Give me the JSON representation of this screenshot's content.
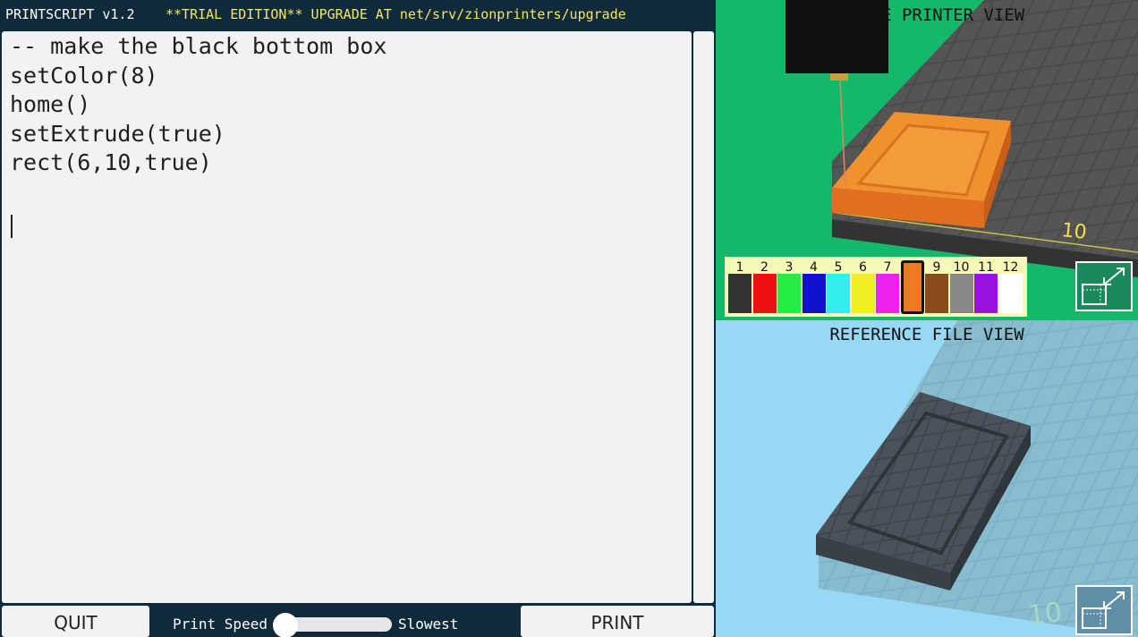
{
  "header": {
    "app_title": "PRINTSCRIPT v1.2",
    "trial_notice": "**TRIAL EDITION** UPGRADE AT net/srv/zionprinters/upgrade"
  },
  "editor": {
    "lines": [
      "-- make the black bottom box",
      "setColor(8)",
      "home()",
      "setExtrude(true)",
      "rect(6,10,true)"
    ]
  },
  "footer": {
    "quit_label": "QUIT",
    "speed_label": "Print Speed",
    "slowest_label": "Slowest",
    "print_label": "PRINT",
    "speed_value": 0
  },
  "live_view": {
    "title": "LIVE PRINTER VIEW",
    "grid_label": "10",
    "selected_color": 8,
    "palette": [
      {
        "num": "1",
        "color": "#333333"
      },
      {
        "num": "2",
        "color": "#ee1111"
      },
      {
        "num": "3",
        "color": "#22ee44"
      },
      {
        "num": "4",
        "color": "#1111cc"
      },
      {
        "num": "5",
        "color": "#33eeee"
      },
      {
        "num": "6",
        "color": "#eeee22"
      },
      {
        "num": "7",
        "color": "#ee22ee"
      },
      {
        "num": "8",
        "color": "#f07a22"
      },
      {
        "num": "9",
        "color": "#8a4a1a"
      },
      {
        "num": "10",
        "color": "#888888"
      },
      {
        "num": "11",
        "color": "#9b11dd"
      },
      {
        "num": "12",
        "color": "#ffffff"
      }
    ]
  },
  "reference_view": {
    "title": "REFERENCE FILE VIEW",
    "grid_label": "10"
  }
}
